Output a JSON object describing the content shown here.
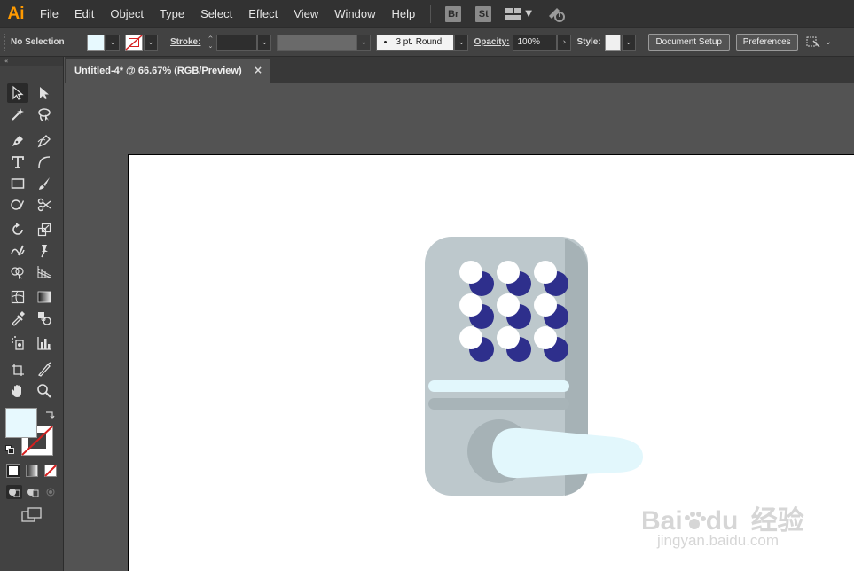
{
  "app": {
    "logo": "Ai"
  },
  "menu": [
    "File",
    "Edit",
    "Object",
    "Type",
    "Select",
    "Effect",
    "View",
    "Window",
    "Help"
  ],
  "menu_icons": {
    "bridge": "Br",
    "stock": "St"
  },
  "control": {
    "selection": "No Selection",
    "stroke_label": "Stroke:",
    "brush_label": "3 pt. Round",
    "opacity_label": "Opacity:",
    "opacity_value": "100%",
    "style_label": "Style:",
    "document_setup": "Document Setup",
    "preferences": "Preferences"
  },
  "document": {
    "tab_title": "Untitled-4* @ 66.67% (RGB/Preview)",
    "close": "×"
  },
  "colors": {
    "fill": "#e7f9fe",
    "lock_body": "#bdc8cc",
    "lock_shadow": "#a6b2b6",
    "dot_white": "#ffffff",
    "dot_navy": "#2e2f8c",
    "light_bar": "#e2f7fc",
    "gray_bar": "#a8b4b8",
    "handle": "#e2f7fc"
  },
  "watermark": {
    "brand": "Bai",
    "brand2": "du",
    "cn": "经验",
    "url": "jingyan.baidu.com"
  }
}
